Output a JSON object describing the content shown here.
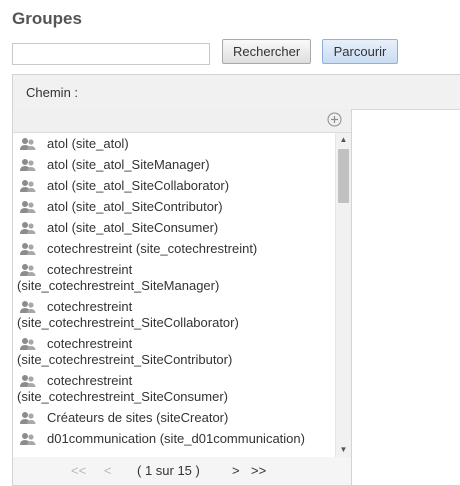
{
  "header": {
    "title": "Groupes"
  },
  "search": {
    "value": "",
    "placeholder": "",
    "search_label": "Rechercher",
    "browse_label": "Parcourir"
  },
  "path": {
    "label": "Chemin :"
  },
  "list": {
    "items": [
      {
        "line1": "atol (site_atol)",
        "line2": ""
      },
      {
        "line1": "atol (site_atol_SiteManager)",
        "line2": ""
      },
      {
        "line1": "atol (site_atol_SiteCollaborator)",
        "line2": ""
      },
      {
        "line1": "atol (site_atol_SiteContributor)",
        "line2": ""
      },
      {
        "line1": "atol (site_atol_SiteConsumer)",
        "line2": ""
      },
      {
        "line1": "cotechrestreint (site_cotechrestreint)",
        "line2": ""
      },
      {
        "line1": "cotechrestreint",
        "line2": "(site_cotechrestreint_SiteManager)"
      },
      {
        "line1": "cotechrestreint",
        "line2": "(site_cotechrestreint_SiteCollaborator)"
      },
      {
        "line1": "cotechrestreint",
        "line2": "(site_cotechrestreint_SiteContributor)"
      },
      {
        "line1": "cotechrestreint",
        "line2": "(site_cotechrestreint_SiteConsumer)"
      },
      {
        "line1": "Créateurs de sites (siteCreator)",
        "line2": ""
      },
      {
        "line1": "d01communication (site_d01communication)",
        "line2": ""
      }
    ]
  },
  "pager": {
    "first": "<<",
    "prev": "<",
    "status": "( 1 sur 15 )",
    "next": ">",
    "last": ">>"
  },
  "icons": {
    "group": "group-icon",
    "add": "add-circle-icon"
  },
  "colors": {
    "title": "#555555",
    "browse_button": "#c9dcf2",
    "path_bar": "#f1f1f1"
  }
}
